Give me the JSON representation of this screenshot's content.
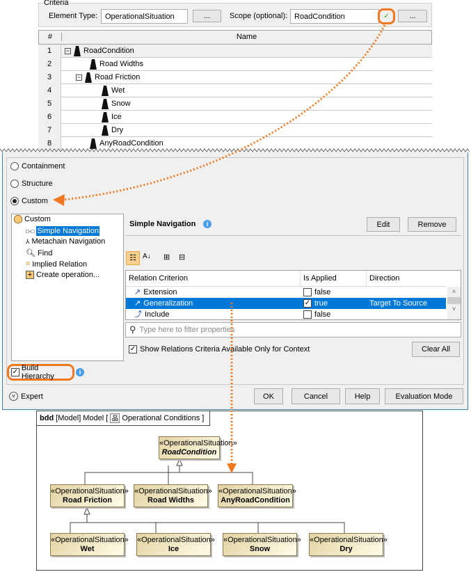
{
  "criteria": {
    "group_label": "Criteria",
    "element_type_label": "Element Type:",
    "element_type_value": "OperationalSituation",
    "browse_label": "...",
    "scope_label": "Scope (optional):",
    "scope_value": "RoadCondition",
    "scope_browse_label": "..."
  },
  "results": {
    "col_num": "#",
    "col_name": "Name",
    "rows": [
      {
        "n": "1",
        "name": "RoadCondition"
      },
      {
        "n": "2",
        "name": "Road Widths"
      },
      {
        "n": "3",
        "name": "Road Friction"
      },
      {
        "n": "4",
        "name": "Wet"
      },
      {
        "n": "5",
        "name": "Snow"
      },
      {
        "n": "6",
        "name": "Ice"
      },
      {
        "n": "7",
        "name": "Dry"
      },
      {
        "n": "8",
        "name": "AnyRoadCondition"
      }
    ]
  },
  "dialog": {
    "radios": [
      "Containment",
      "Structure",
      "Custom"
    ],
    "tree": {
      "root": "Custom",
      "items": [
        "Simple Navigation",
        "Metachain Navigation",
        "Find",
        "Implied Relation",
        "Create operation..."
      ]
    },
    "panel_title": "Simple Navigation",
    "edit": "Edit",
    "remove": "Remove",
    "table": {
      "headers": [
        "Relation Criterion",
        "Is Applied",
        "Direction"
      ],
      "rows": [
        {
          "criterion": "Extension",
          "applied": "false",
          "direction": ""
        },
        {
          "criterion": "Generalization",
          "applied": "true",
          "direction": "Target To Source"
        },
        {
          "criterion": "Include",
          "applied": "false",
          "direction": ""
        }
      ]
    },
    "filter_placeholder": "Type here to filter properties",
    "show_only_context": "Show Relations Criteria Available Only for Context",
    "clear_all": "Clear All",
    "build_hierarchy": "Build Hierarchy",
    "expert": "Expert",
    "buttons": {
      "ok": "OK",
      "cancel": "Cancel",
      "help": "Help",
      "evaluation": "Evaluation Mode"
    }
  },
  "diagram": {
    "kind": "bdd",
    "ctx1": "[Model]",
    "ctx2": "Model [",
    "name": "Operational Conditions",
    "close": "]",
    "stereotype": "«OperationalSituation»",
    "blocks": {
      "root": "RoadCondition",
      "friction": "Road Friction",
      "widths": "Road Widths",
      "any": "AnyRoadCondition",
      "wet": "Wet",
      "ice": "Ice",
      "snow": "Snow",
      "dry": "Dry"
    }
  },
  "colors": {
    "accent": "#f07820",
    "selection": "#0078d7"
  }
}
